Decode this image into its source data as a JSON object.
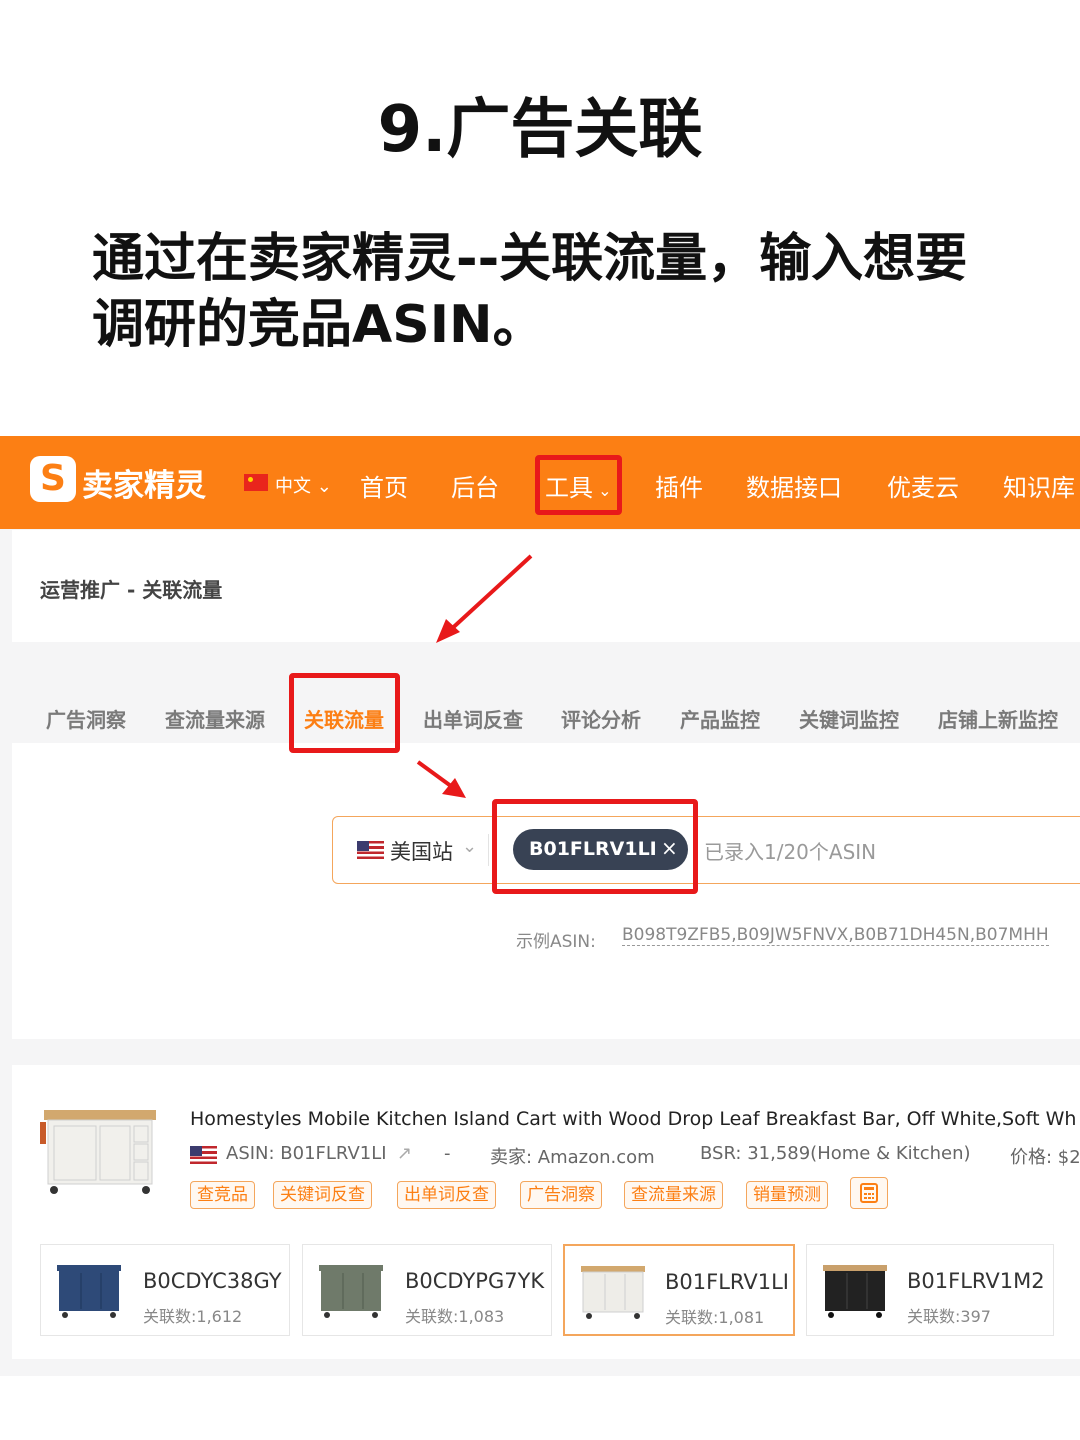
{
  "header": {
    "title": "9.广告关联",
    "instruction_line1": "通过在卖家精灵--关联流量，输入想要",
    "instruction_line2": "调研的竞品ASIN。"
  },
  "navbar": {
    "logo_glyph": "S",
    "logo_text": "卖家精灵",
    "language": "中文",
    "items": [
      "首页",
      "后台",
      "工具",
      "插件",
      "数据接口",
      "优麦云",
      "知识库"
    ],
    "highlighted_item": "工具",
    "background_color": "#fc7f14"
  },
  "breadcrumb": "运营推广 - 关联流量",
  "tabs": [
    {
      "label": "广告洞察"
    },
    {
      "label": "查流量来源"
    },
    {
      "label": "关联流量",
      "active": true
    },
    {
      "label": "出单词反查"
    },
    {
      "label": "评论分析"
    },
    {
      "label": "产品监控"
    },
    {
      "label": "关键词监控"
    },
    {
      "label": "店铺上新监控"
    }
  ],
  "search": {
    "site": "美国站",
    "chip_asin": "B01FLRV1LI",
    "chip_close": "×",
    "placeholder": "已录入1/20个ASIN",
    "example_label": "示例ASIN:",
    "example_values": "B098T9ZFB5,B09JW5FNVX,B0B71DH45N,B07MHH"
  },
  "product": {
    "title": "Homestyles Mobile Kitchen Island Cart with Wood Drop Leaf Breakfast Bar, Off White,Soft Wh",
    "asin_label": "ASIN: B01FLRV1LI",
    "separator": "-",
    "seller": "卖家: Amazon.com",
    "bsr": "BSR: 31,589(Home & Kitchen)",
    "price": "价格: $2",
    "tags": [
      "查竞品",
      "关键词反查",
      "出单词反查",
      "广告洞察",
      "查流量来源",
      "销量预测"
    ],
    "calc_icon": "calculator-icon"
  },
  "related_cards": [
    {
      "asin": "B0CDYC38GY",
      "count": "关联数:1,612",
      "color": "#2e4a78"
    },
    {
      "asin": "B0CDYPG7YK",
      "count": "关联数:1,083",
      "color": "#6f7a6a"
    },
    {
      "asin": "B01FLRV1LI",
      "count": "关联数:1,081",
      "color": "#e8e6e0",
      "selected": true
    },
    {
      "asin": "B01FLRV1M2",
      "count": "关联数:397",
      "color": "#222222"
    }
  ],
  "colors": {
    "accent": "#fc7f14",
    "highlight_red": "#e8191a",
    "chip_bg": "#384254"
  }
}
